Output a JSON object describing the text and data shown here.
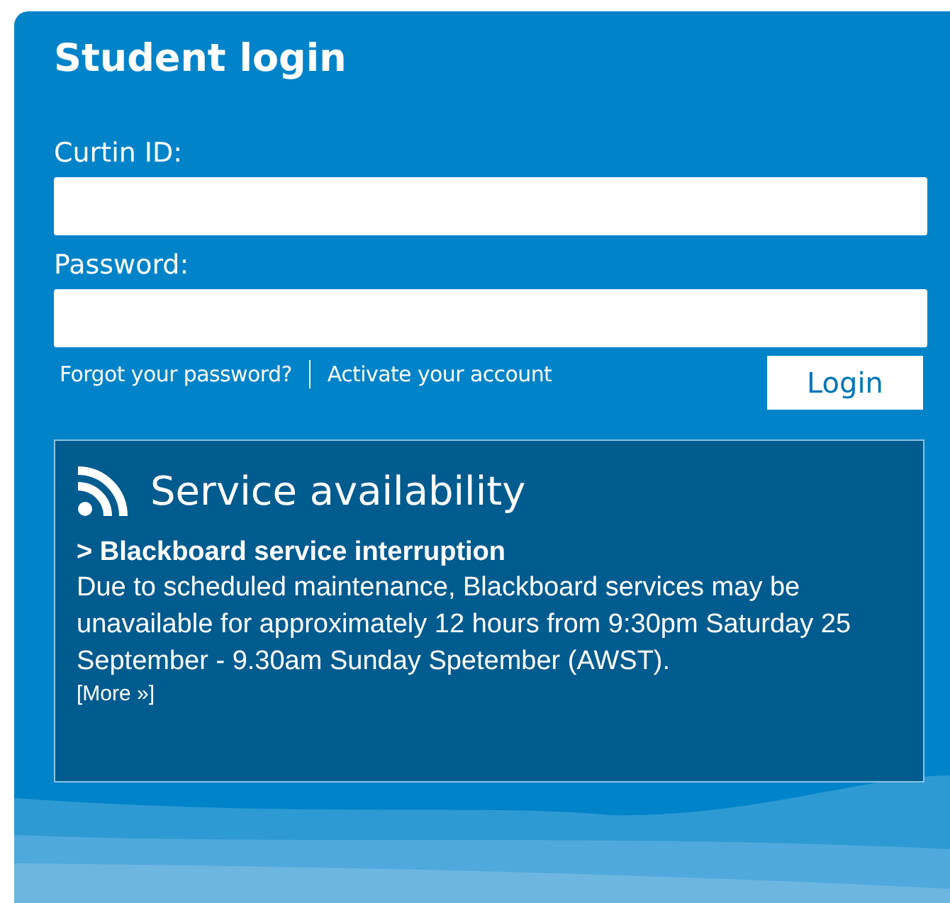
{
  "title": "Student login",
  "fields": [
    {
      "label": "Curtin ID:"
    },
    {
      "label": "Password:"
    }
  ],
  "links": [
    "Forgot your password?",
    "Activate your account"
  ],
  "login_button": "Login",
  "service": {
    "title": "Service availability",
    "headline": "> Blackboard service interruption",
    "body": "Due to scheduled maintenance, Blackboard services may be unavailable for approximately 12 hours from 9:30pm Saturday 25 September - 9.30am Sunday Spetember (AWST).",
    "more": "[More »]"
  }
}
